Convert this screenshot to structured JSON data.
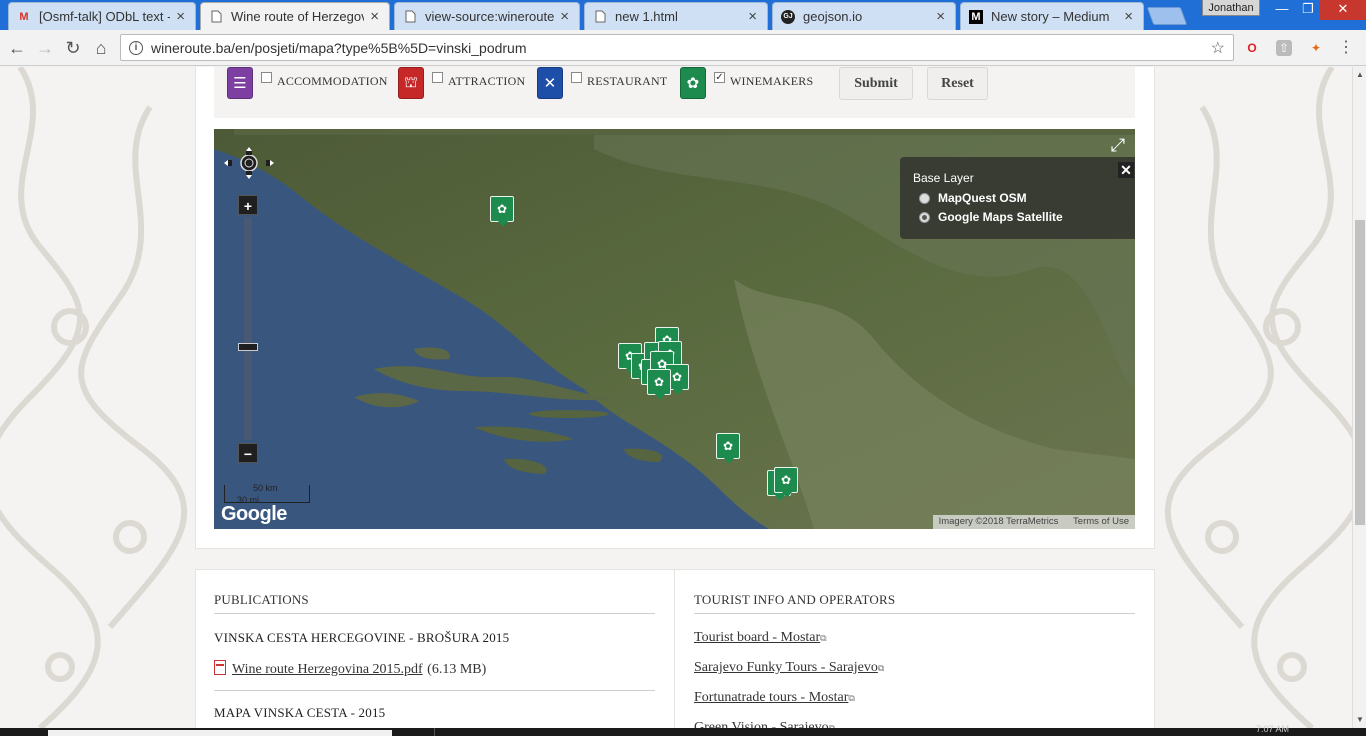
{
  "browser": {
    "tabs": [
      {
        "title": "[Osmf-talk] ODbL text -",
        "icon": "gmail-icon",
        "active": false
      },
      {
        "title": "Wine route of Herzegov",
        "icon": "page-icon",
        "active": true
      },
      {
        "title": "view-source:wineroute.b",
        "icon": "page-icon",
        "active": false
      },
      {
        "title": "new 1.html",
        "icon": "page-icon",
        "active": false
      },
      {
        "title": "geojson.io",
        "icon": "geojson-icon",
        "active": false
      },
      {
        "title": "New story – Medium",
        "icon": "medium-icon",
        "active": false
      }
    ],
    "tab_icons": {
      "gmail": "M",
      "geojson": "GJ",
      "medium": "M"
    },
    "profile": "Jonathan",
    "url": "wineroute.ba/en/posjeti/mapa?type%5B%5D=vinski_podrum",
    "clock_partial": "7:07 AM"
  },
  "filters": [
    {
      "label": "ACCOMMODATION",
      "checked": false,
      "color": "#7e3fa3",
      "icon": "bed-icon"
    },
    {
      "label": "ATTRACTION",
      "checked": false,
      "color": "#c62828",
      "icon": "landmark-icon"
    },
    {
      "label": "RESTAURANT",
      "checked": false,
      "color": "#1e4fa8",
      "icon": "fork-knife-icon"
    },
    {
      "label": "WINEMAKERS",
      "checked": true,
      "color": "#1d8a4e",
      "icon": "grapes-icon"
    }
  ],
  "buttons": {
    "submit": "Submit",
    "reset": "Reset"
  },
  "map": {
    "layer_title": "Base Layer",
    "layers": [
      {
        "name": "MapQuest OSM",
        "selected": false
      },
      {
        "name": "Google Maps Satellite",
        "selected": true
      }
    ],
    "scale_label": "50 km",
    "scale_label_mi": "30 mi",
    "google_logo": "Google",
    "imagery": "Imagery ©2018 TerraMetrics",
    "terms": "Terms of Use",
    "pin_count": 13
  },
  "publications": {
    "title": "PUBLICATIONS",
    "items": [
      {
        "heading": "VINSKA CESTA HERCEGOVINE - BROŠURA 2015",
        "file": "Wine route Herzegovina 2015.pdf",
        "size": "(6.13 MB)"
      },
      {
        "heading": "MAPA VINSKA CESTA - 2015",
        "file": "",
        "size": ""
      }
    ]
  },
  "tourist": {
    "title": "TOURIST INFO AND OPERATORS",
    "links": [
      "Tourist board - Mostar",
      "Sarajevo Funky Tours - Sarajevo",
      "Fortunatrade tours - Mostar",
      "Green Vision - Sarajevo"
    ]
  }
}
